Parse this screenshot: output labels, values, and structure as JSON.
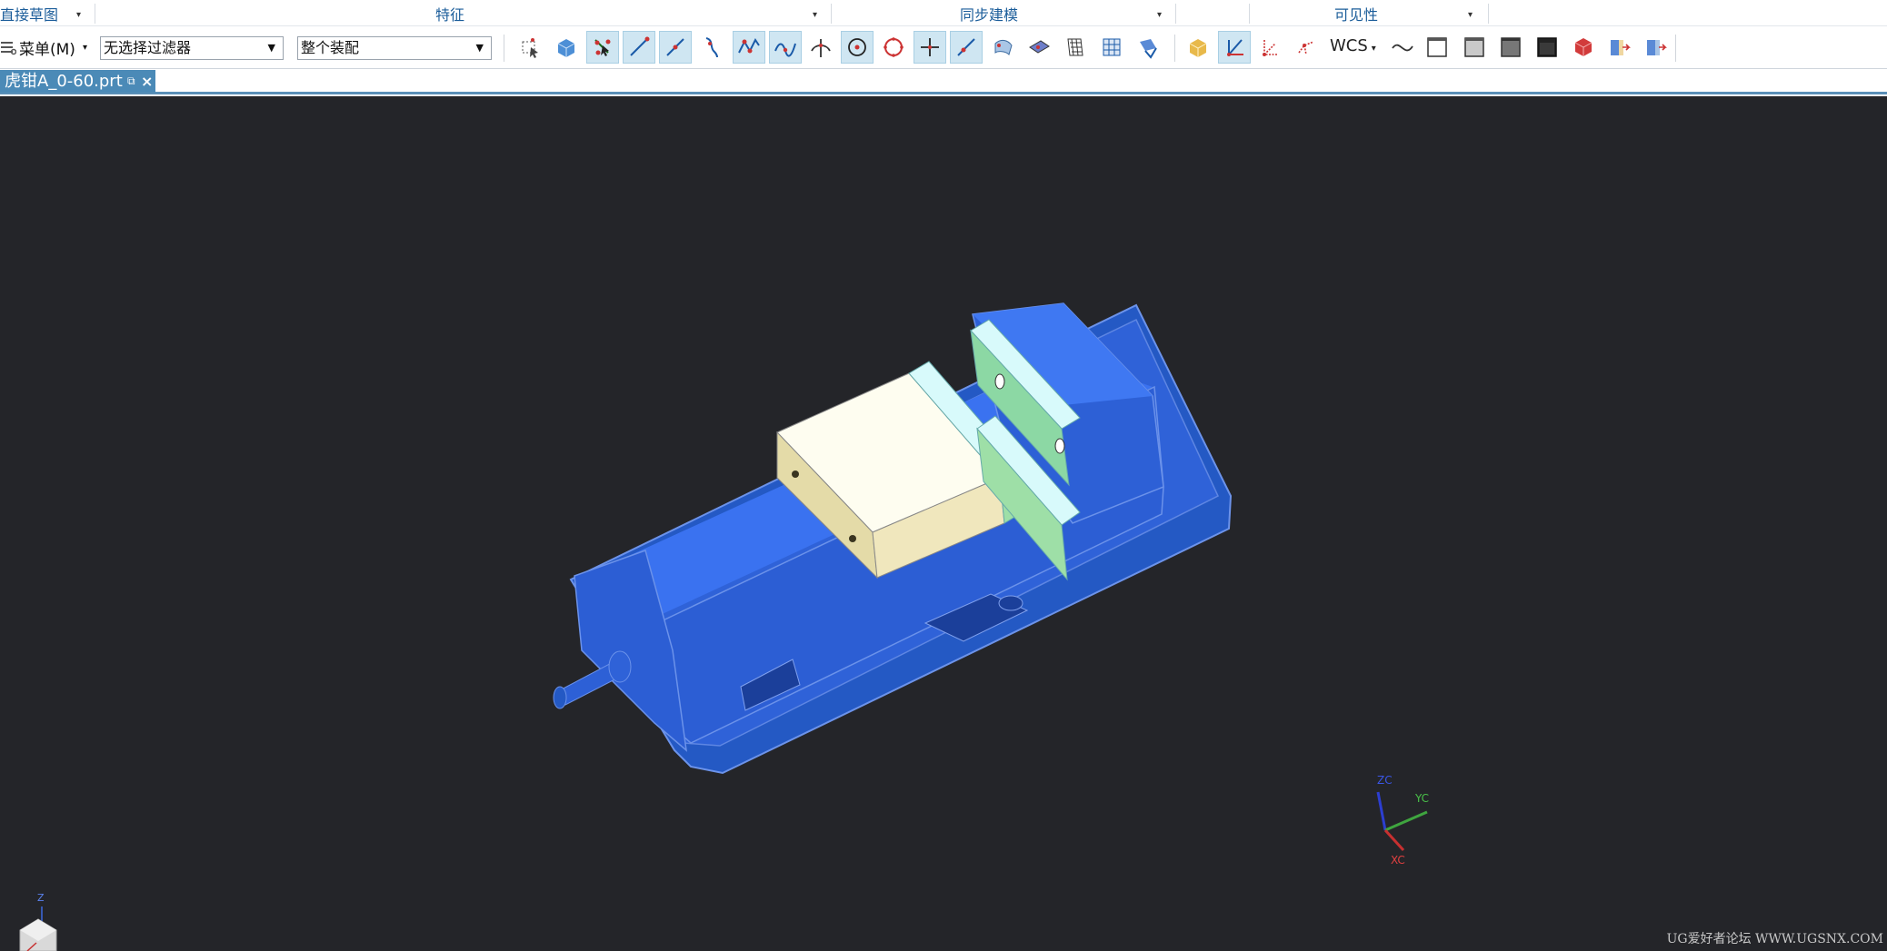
{
  "ribbon_groups": {
    "direct_sketch": "直接草图",
    "feature": "特征",
    "sync_modeling": "同步建模",
    "visibility": "可见性"
  },
  "toolbar": {
    "menu_label": "菜单(M)",
    "selection_filter": "无选择过滤器",
    "selection_scope": "整个装配",
    "wcs_label": "WCS"
  },
  "document_tab": {
    "title": "虎钳A_0-60.prt"
  },
  "triad": {
    "zc": "ZC",
    "yc": "YC",
    "xc": "XC"
  },
  "view_cube": {
    "z_label": "Z"
  },
  "watermark": "UG爱好者论坛 WWW.UGSNX.COM",
  "colors": {
    "accent": "#1b5d9a",
    "tab_active": "#4b8ab7",
    "viewport_bg": "#242529",
    "vise_body": "#2f62d8",
    "jaw_block": "#fbf7dd",
    "jaw_plate": "#8cd8a4"
  },
  "icons": [
    "select-snap-icon",
    "solid-box-icon",
    "snap-point-icon",
    "endpoint-icon",
    "midpoint-icon",
    "curve-icon",
    "control-point-icon",
    "spline-icon",
    "intersection-icon",
    "arc-center-icon",
    "quadrant-icon",
    "point-on-curve-icon",
    "point-on-face-icon",
    "surface-icon",
    "face-icon",
    "grid-icon",
    "bounded-grid-icon",
    "table-icon",
    "shaded-solid-icon",
    "wcs-triad-icon",
    "wcs-dynamic-icon",
    "wcs-origin-icon",
    "wave-icon",
    "shade-light-icon",
    "shade-mid-icon",
    "shade-dark-icon",
    "shade-black-icon",
    "red-cube-icon",
    "show-icon",
    "hide-icon"
  ]
}
